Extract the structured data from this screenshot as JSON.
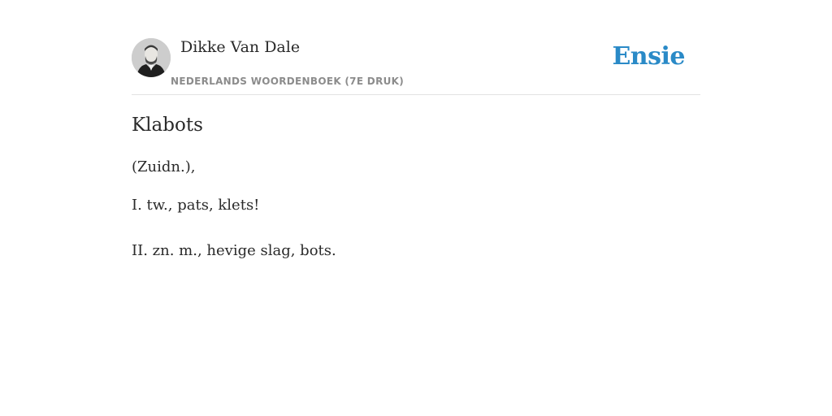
{
  "header": {
    "author_name": "Dikke Van Dale",
    "dictionary_name": "NEDERLANDS WOORDENBOEK (7E DRUK)",
    "brand": "Ensie",
    "brand_color": "#2a8ac7",
    "avatar_icon": "portrait-photo"
  },
  "entry": {
    "headword": "Klabots",
    "lines": [
      "(Zuidn.),",
      "I. tw., pats, klets!",
      "II. zn. m., hevige slag, bots."
    ]
  }
}
